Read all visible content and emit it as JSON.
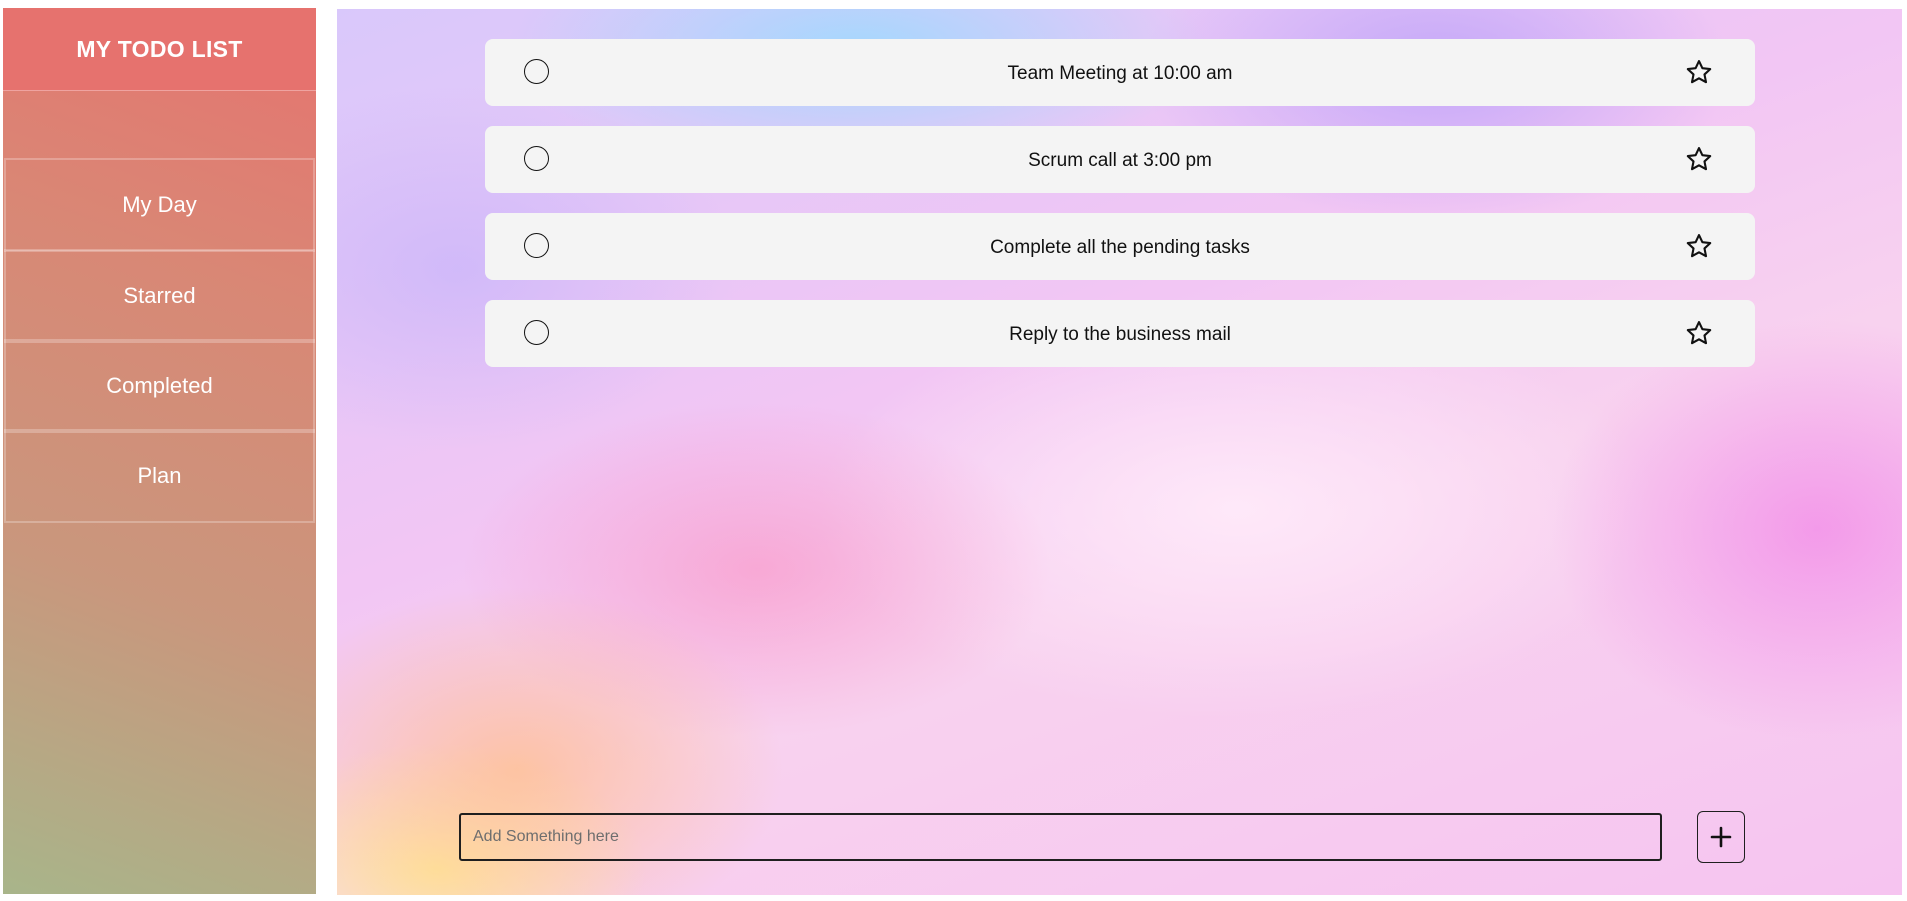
{
  "sidebar": {
    "title": "MY TODO LIST",
    "items": [
      {
        "label": "My Day"
      },
      {
        "label": "Starred"
      },
      {
        "label": "Completed"
      },
      {
        "label": "Plan"
      }
    ]
  },
  "tasks": [
    {
      "text": "Team Meeting at 10:00 am",
      "completed": false,
      "starred": false
    },
    {
      "text": "Scrum call at 3:00 pm",
      "completed": false,
      "starred": false
    },
    {
      "text": "Complete all the pending tasks",
      "completed": false,
      "starred": false
    },
    {
      "text": "Reply to the business mail",
      "completed": false,
      "starred": false
    }
  ],
  "add_task": {
    "placeholder": "Add Something here",
    "value": "",
    "button_icon": "plus-icon"
  },
  "icons": {
    "check": "circle-outline-icon",
    "star": "star-outline-icon"
  },
  "colors": {
    "sidebar_header": "#e6726e",
    "sidebar_text": "#ffffff",
    "task_background": "#f4f4f4",
    "task_text": "#111111"
  }
}
